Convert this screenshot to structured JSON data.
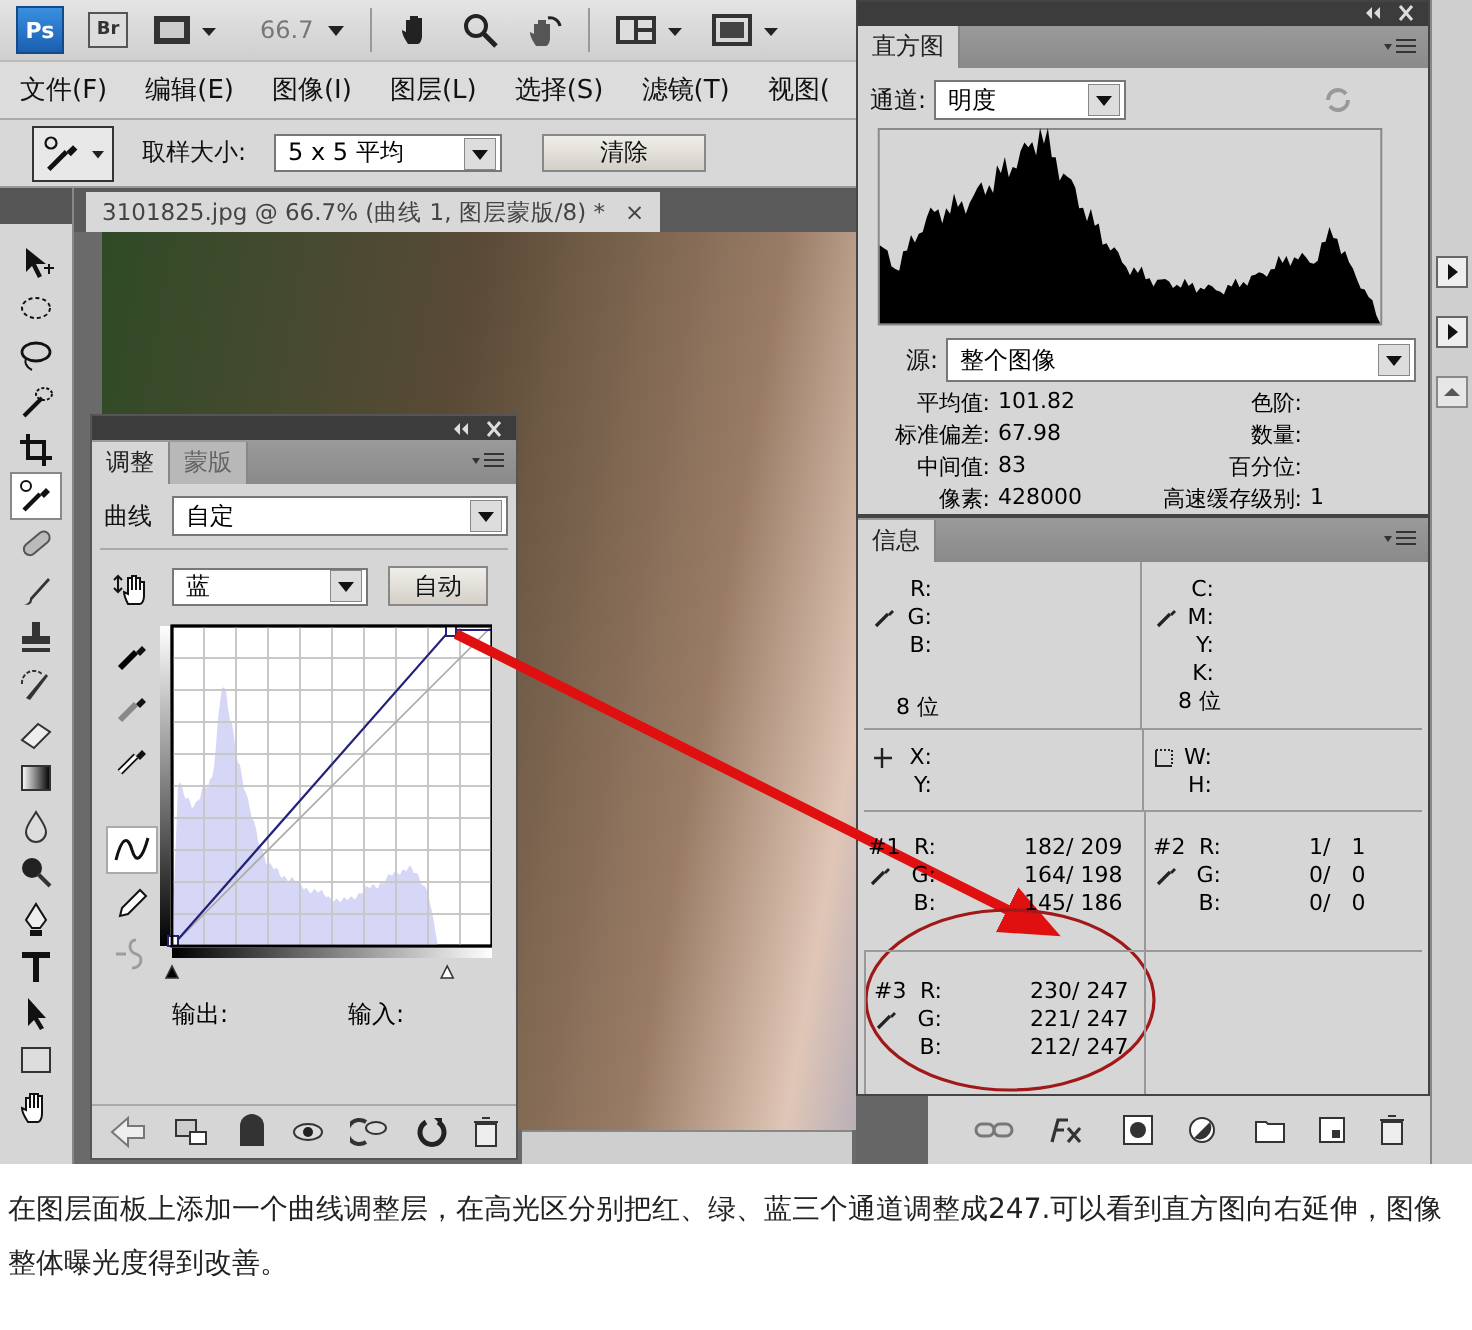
{
  "app_bar": {
    "logo": "Ps",
    "bridge": "Br",
    "zoom": "66.7"
  },
  "menu": [
    {
      "label": "文件(F)"
    },
    {
      "label": "编辑(E)"
    },
    {
      "label": "图像(I)"
    },
    {
      "label": "图层(L)"
    },
    {
      "label": "选择(S)"
    },
    {
      "label": "滤镜(T)"
    },
    {
      "label": "视图("
    }
  ],
  "options_bar": {
    "sample_label": "取样大小:",
    "sample_value": "5 x 5 平均",
    "clear_button": "清除"
  },
  "tools": [
    {
      "kind": "move",
      "selected": false
    },
    {
      "kind": "marquee",
      "selected": false
    },
    {
      "kind": "lasso",
      "selected": false
    },
    {
      "kind": "quick-select",
      "selected": false
    },
    {
      "kind": "crop",
      "selected": false
    },
    {
      "kind": "color-sampler",
      "selected": true
    },
    {
      "kind": "healing",
      "selected": false
    },
    {
      "kind": "brush",
      "selected": false
    },
    {
      "kind": "stamp",
      "selected": false
    },
    {
      "kind": "history-brush",
      "selected": false
    },
    {
      "kind": "eraser",
      "selected": false
    },
    {
      "kind": "gradient",
      "selected": false
    },
    {
      "kind": "blur",
      "selected": false
    },
    {
      "kind": "dodge",
      "selected": false
    },
    {
      "kind": "pen",
      "selected": false
    },
    {
      "kind": "type",
      "selected": false
    },
    {
      "kind": "path-select",
      "selected": false
    },
    {
      "kind": "shape",
      "selected": false
    },
    {
      "kind": "hand",
      "selected": false
    }
  ],
  "document": {
    "tab_title": "3101825.jpg @ 66.7% (曲线 1, 图层蒙版/8) *",
    "close": "×"
  },
  "adjustments": {
    "tabs": [
      {
        "label": "调整",
        "selected": true
      },
      {
        "label": "蒙版",
        "selected": false
      }
    ],
    "preset_label": "曲线",
    "preset_value": "自定",
    "channel_value": "蓝",
    "auto_button": "自动",
    "sliders": [
      {
        "kind": "shadow",
        "level": 0
      },
      {
        "kind": "highlight",
        "level": 0.86
      }
    ],
    "output_label": "输出:",
    "input_label": "输入:",
    "curve_tools": [
      {
        "kind": "hand",
        "selected": false,
        "disabled": false
      },
      {
        "kind": "black-dropper",
        "selected": false,
        "disabled": false
      },
      {
        "kind": "gray-dropper",
        "selected": false,
        "disabled": false
      },
      {
        "kind": "white-dropper",
        "selected": false,
        "disabled": false
      },
      {
        "kind": "curve",
        "selected": true,
        "disabled": false
      },
      {
        "kind": "pencil",
        "selected": false,
        "disabled": false
      },
      {
        "kind": "smooth",
        "selected": false,
        "disabled": true
      }
    ]
  },
  "histogram": {
    "title": "直方图",
    "channel_label": "通道:",
    "channel_value": "明度",
    "source_label": "源:",
    "source_value": "整个图像",
    "left_stats": [
      {
        "label": "平均值:",
        "value": "101.82"
      },
      {
        "label": "标准偏差:",
        "value": "67.98"
      },
      {
        "label": "中间值:",
        "value": "83"
      },
      {
        "label": "像素:",
        "value": "428000"
      }
    ],
    "right_stats": [
      {
        "label": "色阶:"
      },
      {
        "label": "数量:"
      },
      {
        "label": "百分位:"
      },
      {
        "label": "高速缓存级别:",
        "value": "1"
      }
    ]
  },
  "info": {
    "title": "信息",
    "rgb_labels": [
      "R:",
      "G:",
      "B:"
    ],
    "rgb_depth": "8 位",
    "cmyk_labels": [
      "C:",
      "M:",
      "Y:",
      "K:"
    ],
    "cmyk_depth": "8 位",
    "xy_labels": [
      "X:",
      "Y:"
    ],
    "wh_labels": [
      "W:",
      "H:"
    ],
    "samplers": [
      {
        "label": "#1",
        "rows": [
          {
            "channel": "R:",
            "value": "182/ 209"
          },
          {
            "channel": "G:",
            "value": "164/ 198"
          },
          {
            "channel": "B:",
            "value": "145/ 186"
          }
        ]
      },
      {
        "label": "#2",
        "rows": [
          {
            "channel": "R:",
            "value": "1/   1"
          },
          {
            "channel": "G:",
            "value": "0/   0"
          },
          {
            "channel": "B:",
            "value": "0/   0"
          }
        ]
      },
      {
        "label": "#3",
        "rows": [
          {
            "channel": "R:",
            "value": "230/ 247"
          },
          {
            "channel": "G:",
            "value": "221/ 247"
          },
          {
            "channel": "B:",
            "value": "212/ 247"
          }
        ]
      }
    ]
  },
  "caption": "在图层面板上添加一个曲线调整层，在高光区分别把红、绿、蓝三个通道调整成247.可以看到直方图向右延伸，图像整体曝光度得到改善。"
}
